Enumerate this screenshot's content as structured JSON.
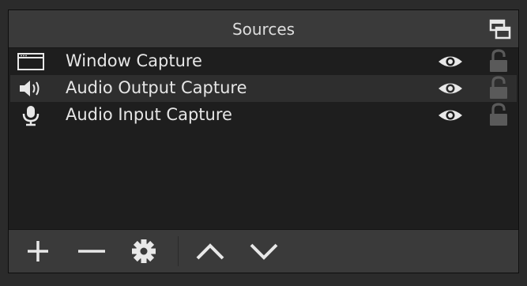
{
  "panel": {
    "title": "Sources"
  },
  "sources": [
    {
      "label": "Window Capture",
      "type_icon": "window-icon",
      "visible": true,
      "locked": false
    },
    {
      "label": "Audio Output Capture",
      "type_icon": "speaker-icon",
      "visible": true,
      "locked": false
    },
    {
      "label": "Audio Input Capture",
      "type_icon": "microphone-icon",
      "visible": true,
      "locked": false
    }
  ],
  "toolbar": {
    "buttons": [
      "add-icon",
      "remove-icon",
      "gear-icon",
      "chevron-up-icon",
      "chevron-down-icon"
    ]
  },
  "colors": {
    "panel_bg": "#1e1e1e",
    "header_bg": "#3a3a3a",
    "row_alt_bg": "#2e2e2e",
    "text": "#e6e6e6",
    "icon": "#e8e8e8"
  }
}
